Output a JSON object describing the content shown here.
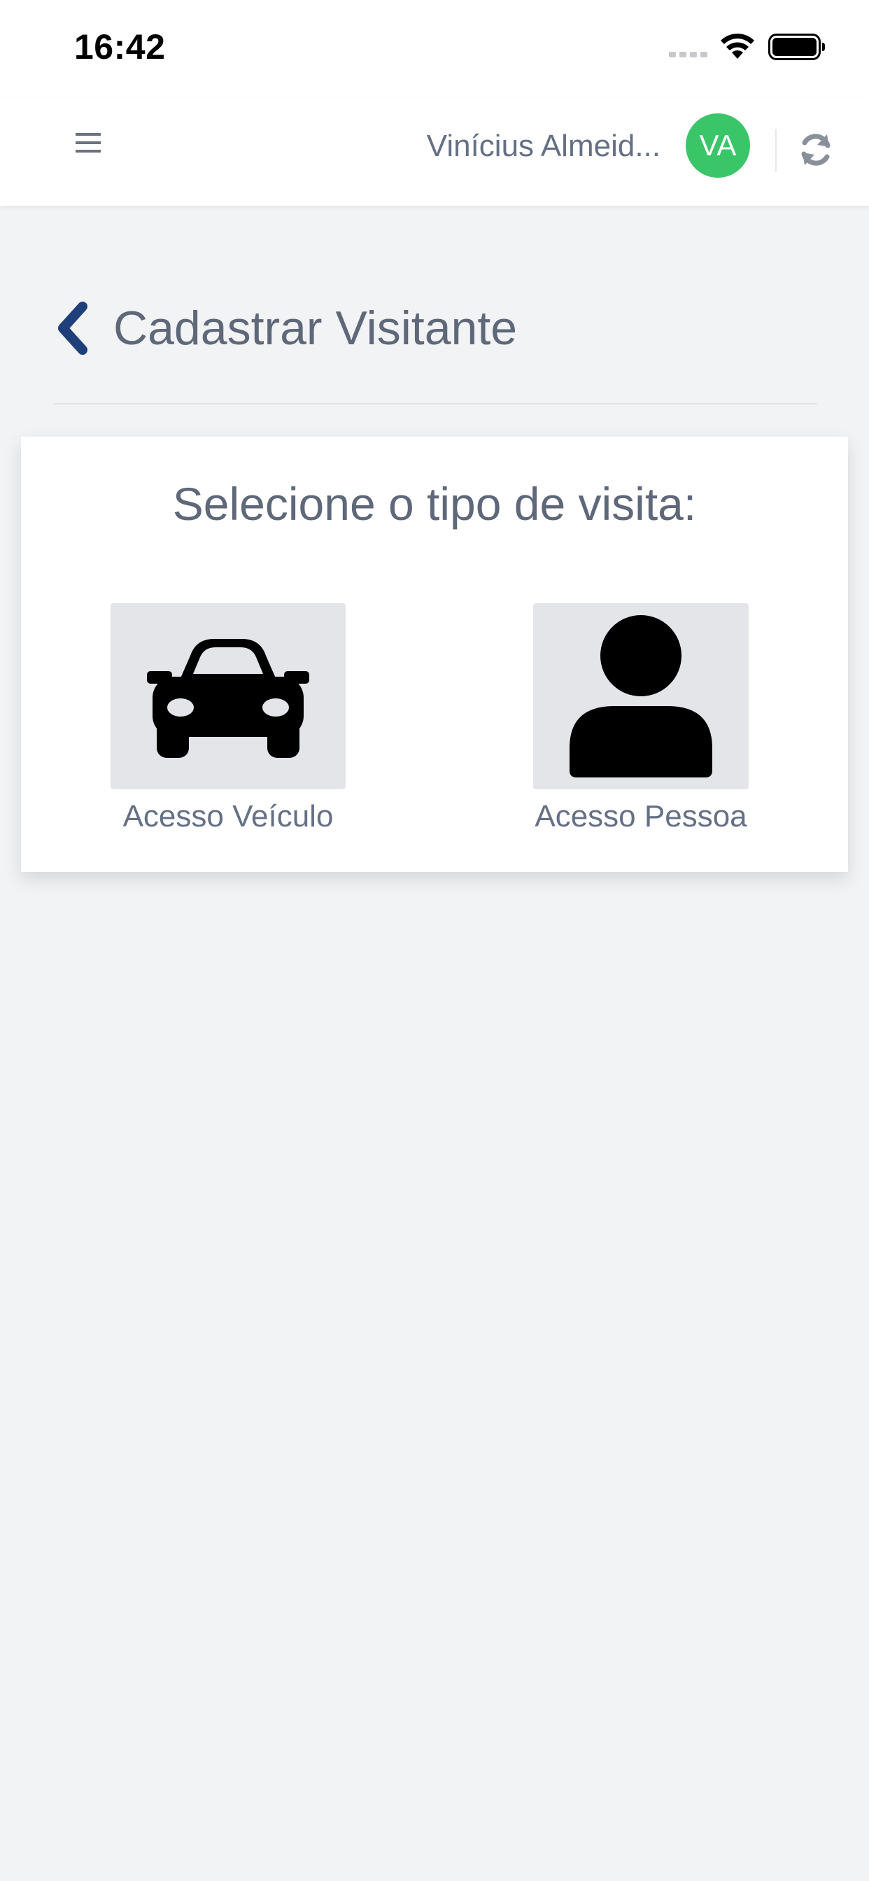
{
  "status_bar": {
    "time": "16:42"
  },
  "header": {
    "user_name": "Vinícius Almeid...",
    "avatar_initials": "VA",
    "avatar_color": "#3ac569"
  },
  "page": {
    "title": "Cadastrar Visitante",
    "back_icon": "chevron-left-icon",
    "accent_color": "#1f3f7a"
  },
  "card": {
    "title": "Selecione o tipo de visita:",
    "options": [
      {
        "label": "Acesso Veículo",
        "icon": "car-icon"
      },
      {
        "label": "Acesso Pessoa",
        "icon": "user-icon"
      }
    ]
  }
}
